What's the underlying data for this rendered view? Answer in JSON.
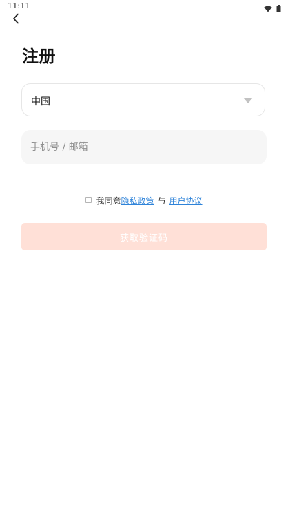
{
  "status_bar": {
    "time": "11:11",
    "icons": [
      "wifi-icon",
      "battery-icon"
    ]
  },
  "header": {
    "back_icon": "chevron-left-icon",
    "title": "注册"
  },
  "form": {
    "country": {
      "value": "中国",
      "icon": "triangle-down-icon"
    },
    "account": {
      "value": "",
      "placeholder": "手机号 / 邮箱"
    },
    "agreement": {
      "checked": false,
      "prefix": "我同意",
      "privacy_link": "隐私政策",
      "connector": "与",
      "terms_link": "用户协议"
    },
    "submit_label": "获取验证码"
  },
  "colors": {
    "link": "#2e83d9",
    "submit_disabled_bg": "#ffe0d7",
    "input_bg": "#f6f6f6"
  }
}
